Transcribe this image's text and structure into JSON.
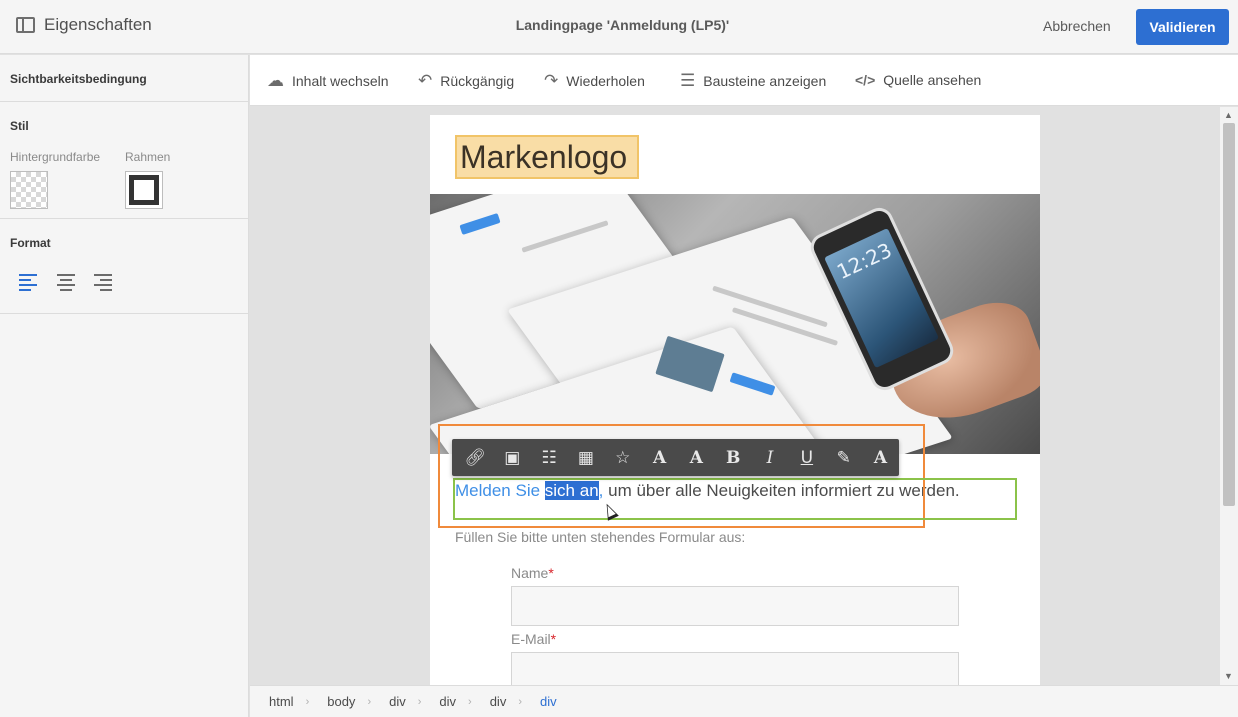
{
  "header": {
    "properties_label": "Eigenschaften",
    "title": "Landingpage 'Anmeldung (LP5)'",
    "cancel_label": "Abbrechen",
    "validate_label": "Validieren"
  },
  "sidebar": {
    "visibility_title": "Sichtbarkeitsbedingung",
    "style_title": "Stil",
    "background_label": "Hintergrundfarbe",
    "border_label": "Rahmen",
    "format_title": "Format",
    "align_active": "left"
  },
  "toolbar": {
    "switch_content": "Inhalt wechseln",
    "undo": "Rückgängig",
    "redo": "Wiederholen",
    "show_blocks": "Bausteine anzeigen",
    "view_source": "Quelle ansehen"
  },
  "page": {
    "logo_text": "Markenlogo",
    "headline_part1": "Melden Sie ",
    "headline_selected": "sich an",
    "headline_part2": ",",
    "headline_part3": " um über alle Neuigkeiten informiert zu werden.",
    "subtext": "Füllen Sie bitte unten stehendes Formular aus:",
    "name_label": "Name",
    "email_label": "E-Mail",
    "required_mark": "*",
    "phone_time": "12:23"
  },
  "rte_tools": [
    "link-icon",
    "personalize-icon",
    "content-block-icon",
    "dynamic-content-icon",
    "image-icon",
    "text-color-icon",
    "background-color-icon",
    "bold-icon",
    "italic-icon",
    "underline-icon",
    "eyedropper-icon",
    "clear-format-icon"
  ],
  "breadcrumb": [
    "html",
    "body",
    "div",
    "div",
    "div",
    "div"
  ],
  "colors": {
    "accent": "#2d6fd2",
    "orange_frame": "#f08a3b",
    "green_frame": "#8bc34a",
    "logo_bg": "#f9dda6"
  }
}
